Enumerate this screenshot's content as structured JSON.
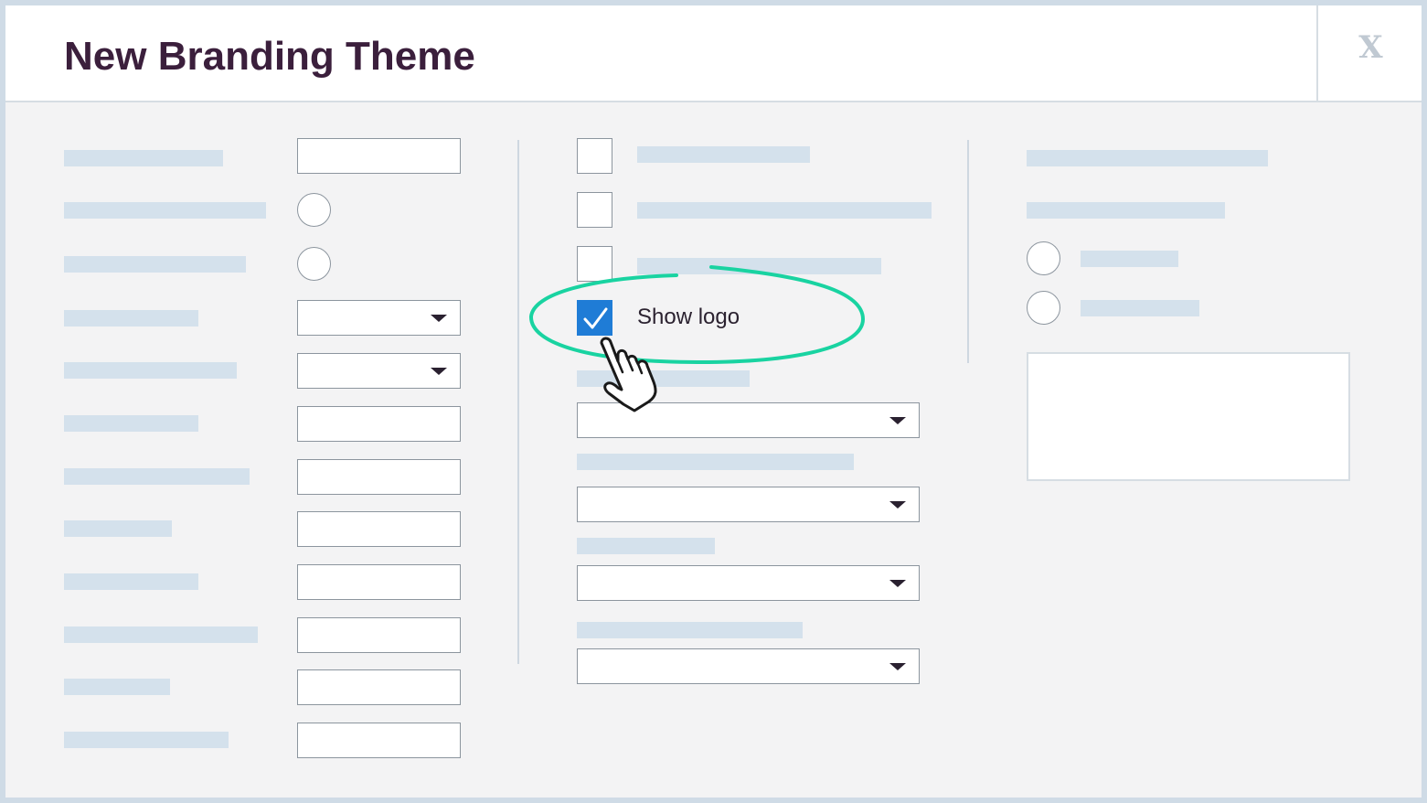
{
  "dialog": {
    "title": "New Branding Theme",
    "close_label": "X"
  },
  "middle": {
    "show_logo_label": "Show logo",
    "show_logo_checked": true
  },
  "annotations": {
    "highlight_color": "#19d3a1",
    "cursor_icon": "hand-pointer-icon"
  },
  "colors": {
    "title": "#3b1f3c",
    "placeholder_bar": "#d4e1ec",
    "checkbox_checked": "#1f7cd6",
    "background": "#f3f3f4"
  }
}
